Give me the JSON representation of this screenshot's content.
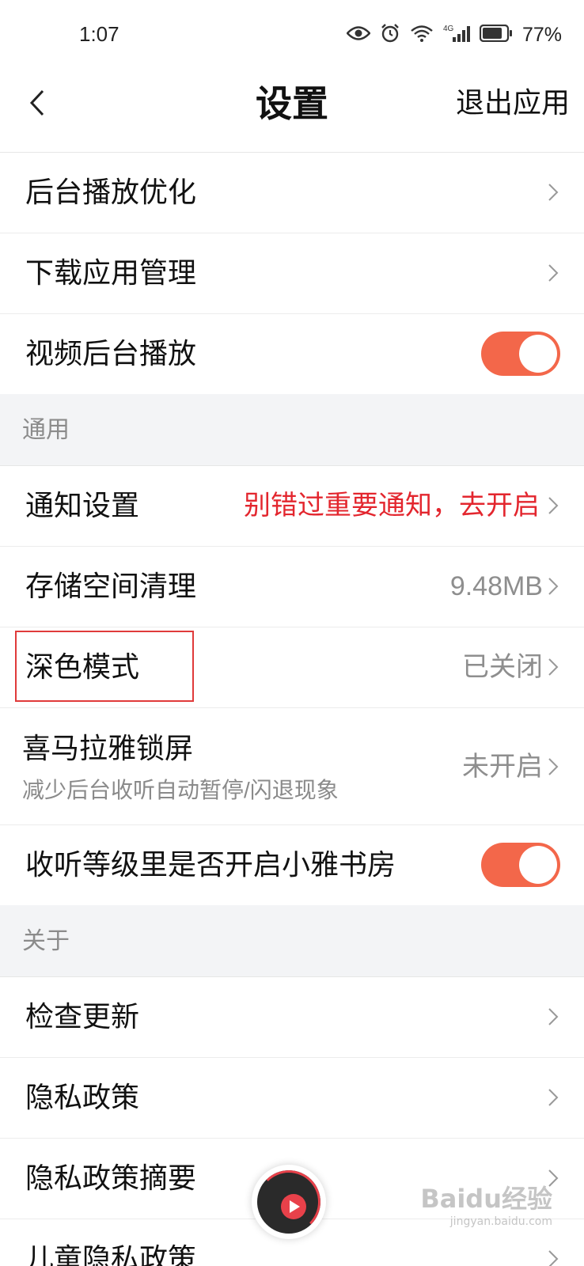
{
  "status_bar": {
    "time": "1:07",
    "network": "4G",
    "battery": "77%"
  },
  "header": {
    "title": "设置",
    "exit_label": "退出应用"
  },
  "rows_top": [
    {
      "label": "后台播放优化",
      "type": "link"
    },
    {
      "label": "下载应用管理",
      "type": "link"
    },
    {
      "label": "视频后台播放",
      "type": "toggle",
      "on": true
    }
  ],
  "sections": {
    "general": "通用",
    "about": "关于"
  },
  "general_rows": {
    "notify": {
      "label": "通知设置",
      "value": "别错过重要通知，去开启"
    },
    "storage": {
      "label": "存储空间清理",
      "value": "9.48MB"
    },
    "dark": {
      "label": "深色模式",
      "value": "已关闭"
    },
    "lockscreen": {
      "label": "喜马拉雅锁屏",
      "sub": "减少后台收听自动暂停/闪退现象",
      "value": "未开启"
    },
    "study": {
      "label": "收听等级里是否开启小雅书房",
      "on": true
    }
  },
  "about_rows": [
    {
      "label": "检查更新"
    },
    {
      "label": "隐私政策"
    },
    {
      "label": "隐私政策摘要"
    },
    {
      "label": "儿童隐私政策"
    }
  ],
  "watermark": {
    "text": "Baidu经验",
    "url": "jingyan.baidu.com"
  },
  "colors": {
    "accent": "#f3674a",
    "alert_red": "#e3262e",
    "section_bg": "#f3f4f6"
  }
}
